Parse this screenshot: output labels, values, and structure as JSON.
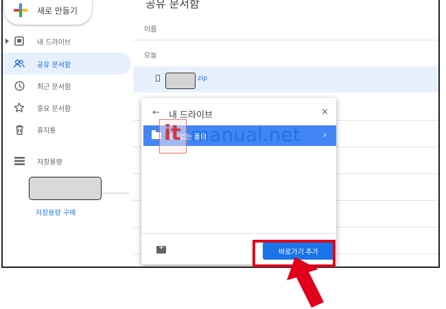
{
  "sidebar": {
    "new_button": "새로 만들기",
    "items": [
      {
        "label": "내 드라이브",
        "icon": "my-drive-icon"
      },
      {
        "label": "공유 문서함",
        "icon": "shared-people-icon",
        "active": true
      },
      {
        "label": "최근 문서함",
        "icon": "clock-icon"
      },
      {
        "label": "중요 문서함",
        "icon": "star-icon"
      },
      {
        "label": "휴지통",
        "icon": "trash-icon"
      },
      {
        "label": "저장용량",
        "icon": "storage-icon"
      }
    ],
    "buy_storage": "저장용량 구매"
  },
  "main": {
    "title": "공유 문서함",
    "column_name": "이름",
    "section_today": "오늘",
    "file": {
      "name_suffix": "zip"
    }
  },
  "dialog": {
    "back_icon": "←",
    "title": "내 드라이브",
    "close_icon": "×",
    "folder": {
      "name": "제목없는 폴더",
      "chevron": "›"
    },
    "add_shortcut_button": "바로가기 추가"
  },
  "watermark": {
    "prefix": "it",
    "text": "manual.net"
  },
  "colors": {
    "accent": "#1a73e8",
    "selected_row": "#e8f0fe",
    "folder_highlight": "#4285f4",
    "annotation_red": "#e0001b"
  }
}
